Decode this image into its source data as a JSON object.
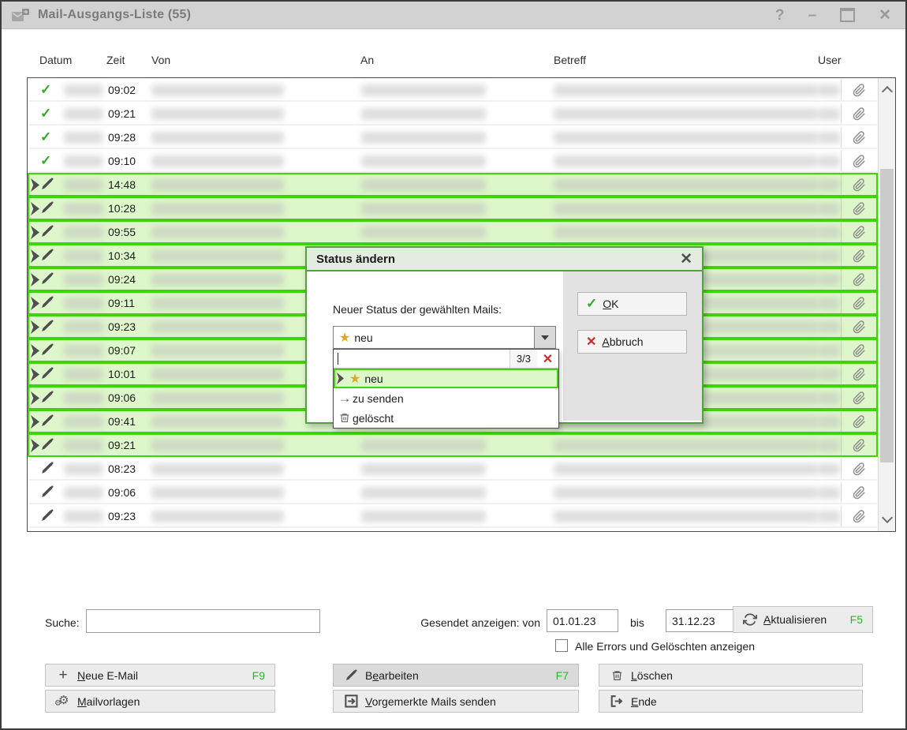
{
  "window": {
    "title": "Mail-Ausgangs-Liste (55)",
    "controls": {
      "help": "?",
      "minimize": "–",
      "close": "✕"
    }
  },
  "colors": {
    "accent_green": "#3fd409",
    "row_green_bg": "#ddf6ca",
    "fkey_green": "#2db32d",
    "star_gold": "#dca724",
    "error_red": "#d3262a",
    "check_green": "#35a829"
  },
  "table": {
    "columns": [
      "Datum",
      "Zeit",
      "Von",
      "An",
      "Betreff",
      "User"
    ],
    "rows": [
      {
        "status": "sent",
        "time": "09:02",
        "selected": false
      },
      {
        "status": "sent",
        "time": "09:21",
        "selected": false
      },
      {
        "status": "sent",
        "time": "09:28",
        "selected": false
      },
      {
        "status": "sent",
        "time": "09:10",
        "selected": false
      },
      {
        "status": "marked",
        "time": "14:48",
        "selected": true
      },
      {
        "status": "marked",
        "time": "10:28",
        "selected": true
      },
      {
        "status": "marked",
        "time": "09:55",
        "selected": true
      },
      {
        "status": "marked",
        "time": "10:34",
        "selected": true
      },
      {
        "status": "marked",
        "time": "09:24",
        "selected": true
      },
      {
        "status": "marked",
        "time": "09:11",
        "selected": true
      },
      {
        "status": "marked",
        "time": "09:23",
        "selected": true
      },
      {
        "status": "marked",
        "time": "09:07",
        "selected": true
      },
      {
        "status": "marked",
        "time": "10:01",
        "selected": true
      },
      {
        "status": "marked",
        "time": "09:06",
        "selected": true
      },
      {
        "status": "marked",
        "time": "09:41",
        "selected": true
      },
      {
        "status": "marked",
        "time": "09:21",
        "selected": true
      },
      {
        "status": "draft",
        "time": "08:23",
        "selected": false
      },
      {
        "status": "draft",
        "time": "09:06",
        "selected": false
      },
      {
        "status": "draft",
        "time": "09:23",
        "selected": false
      }
    ]
  },
  "dialog": {
    "title": "Status ändern",
    "close": "✕",
    "label": "Neuer Status der gewählten Mails:",
    "combo_value": "neu",
    "filter": {
      "value": "",
      "count": "3/3",
      "clear": "✕"
    },
    "options": [
      {
        "icon": "star",
        "label": "neu",
        "selected": true
      },
      {
        "icon": "arrow-right",
        "label": "zu senden",
        "selected": false
      },
      {
        "icon": "trash",
        "label": "gelöscht",
        "selected": false
      }
    ],
    "ok": {
      "pre": "",
      "key": "O",
      "post": "K"
    },
    "cancel": {
      "pre": "",
      "key": "A",
      "post": "bbruch"
    }
  },
  "footer": {
    "search_label": "Suche:",
    "search_value": "",
    "sent_label": "Gesendet anzeigen: von",
    "date_from": "01.01.23",
    "bis_label": "bis",
    "date_to": "31.12.23",
    "refresh": {
      "pre": "",
      "key": "A",
      "post": "ktualisieren",
      "fkey": "F5"
    },
    "checkbox_label": "Alle Errors und Gelöschten anzeigen",
    "buttons": {
      "new": {
        "pre": "",
        "key": "N",
        "post": "eue E-Mail",
        "fkey": "F9"
      },
      "templates": {
        "pre": "",
        "key": "M",
        "post": "ailvorlagen",
        "fkey": ""
      },
      "edit": {
        "pre": "B",
        "key": "e",
        "post": "arbeiten",
        "fkey": "F7"
      },
      "send": {
        "pre": "",
        "key": "V",
        "post": "orgemerkte Mails senden",
        "fkey": ""
      },
      "delete": {
        "pre": "",
        "key": "L",
        "post": "öschen",
        "fkey": ""
      },
      "end": {
        "pre": "",
        "key": "E",
        "post": "nde",
        "fkey": ""
      }
    }
  }
}
